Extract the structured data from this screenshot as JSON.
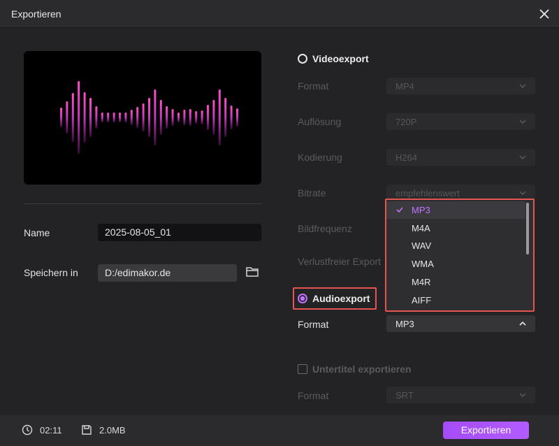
{
  "window": {
    "title": "Exportieren"
  },
  "left": {
    "name_label": "Name",
    "name_value": "2025-08-05_01",
    "save_label": "Speichern in",
    "save_value": "D:/edimakor.de"
  },
  "video": {
    "title": "Videoexport",
    "rows": [
      {
        "label": "Format",
        "value": "MP4"
      },
      {
        "label": "Auflösung",
        "value": "720P"
      },
      {
        "label": "Kodierung",
        "value": "H264"
      },
      {
        "label": "Bitrate",
        "value": "empfehlenswert"
      },
      {
        "label": "Bildfrequenz",
        "value": ""
      },
      {
        "label": "Verlustfreier Export",
        "value": ""
      }
    ]
  },
  "dropdown": {
    "options": [
      "MP3",
      "M4A",
      "WAV",
      "WMA",
      "M4R",
      "AIFF"
    ],
    "selected": "MP3"
  },
  "audio": {
    "title": "Audioexport",
    "format_label": "Format",
    "format_value": "MP3"
  },
  "subtitle": {
    "title": "Untertitel exportieren",
    "format_label": "Format",
    "format_value": "SRT"
  },
  "footer": {
    "duration": "02:11",
    "size": "2.0MB",
    "export_label": "Exportieren"
  },
  "colors": {
    "accent": "#c173ff",
    "highlight": "#e4564f",
    "button": "#a54cf6"
  }
}
